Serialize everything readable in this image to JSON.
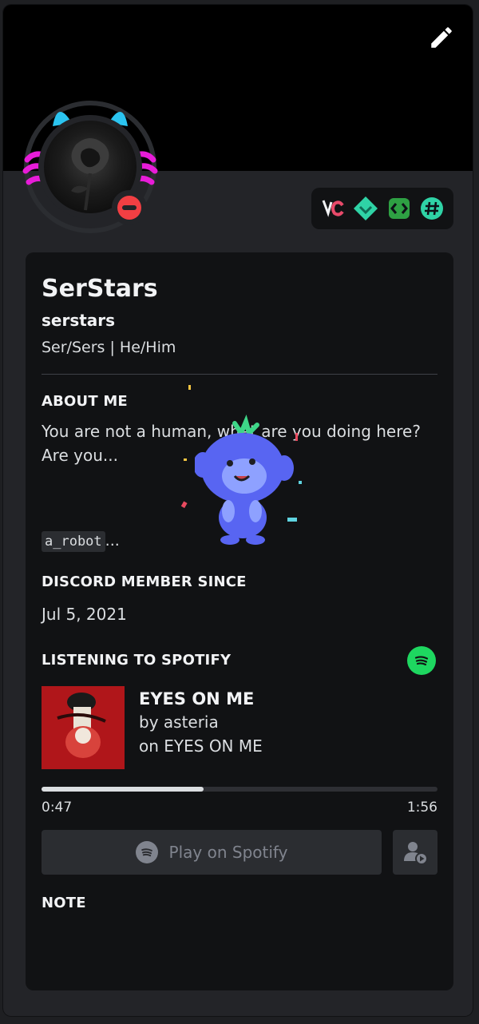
{
  "profile": {
    "display_name": "SerStars",
    "username": "serstars",
    "pronouns": "Ser/Sers | He/Him",
    "status": "do-not-disturb",
    "badges": [
      {
        "icon": "vc-badge-icon"
      },
      {
        "icon": "hypesquad-icon"
      },
      {
        "icon": "active-developer-icon"
      },
      {
        "icon": "hashtag-icon"
      }
    ]
  },
  "about": {
    "title": "ABOUT ME",
    "text": "You are not a human, what are you doing here? Are you...",
    "code": "a_robot",
    "code_trail": "..."
  },
  "member_since": {
    "title": "DISCORD MEMBER SINCE",
    "date": "Jul 5, 2021"
  },
  "spotify": {
    "title": "LISTENING TO SPOTIFY",
    "track": "EYES ON ME",
    "artist_line": "by asteria",
    "album_line": "on EYES ON ME",
    "elapsed": "0:47",
    "duration": "1:56",
    "progress": 0.41,
    "play_label": "Play on Spotify",
    "brand_color": "#1ed760"
  },
  "note": {
    "title": "NOTE"
  }
}
